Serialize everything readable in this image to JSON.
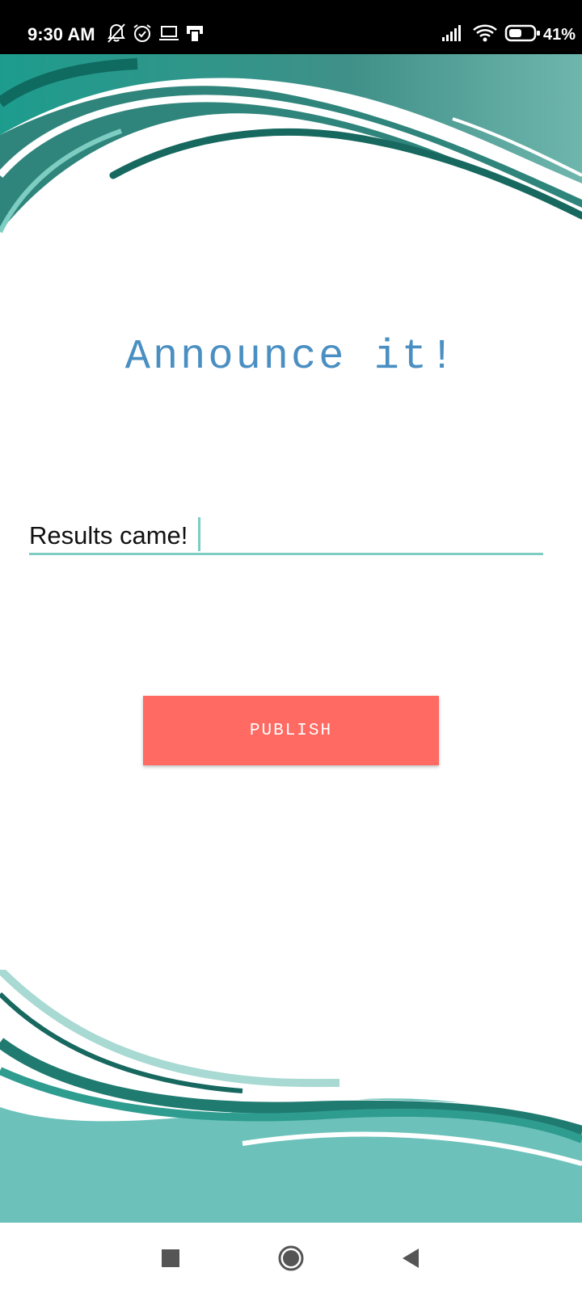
{
  "status_bar": {
    "time": "9:30 AM",
    "battery_percent": "41%",
    "icons": [
      "mute-icon",
      "alarm-icon",
      "laptop-icon",
      "device-icon",
      "signal-icon",
      "wifi-icon",
      "battery-icon"
    ]
  },
  "main": {
    "title": "Announce it!",
    "input_value": "Results came!",
    "publish_label": "PUBLISH"
  },
  "nav_bar": {
    "icons": [
      "recents-icon",
      "home-icon",
      "back-icon"
    ]
  },
  "colors": {
    "title": "#4a8fc2",
    "accent_teal": "#7ecdc3",
    "wave_dark": "#1f7a70",
    "wave_light": "#6cc2ba",
    "button": "#ff6a62",
    "status_bar": "#000000"
  }
}
